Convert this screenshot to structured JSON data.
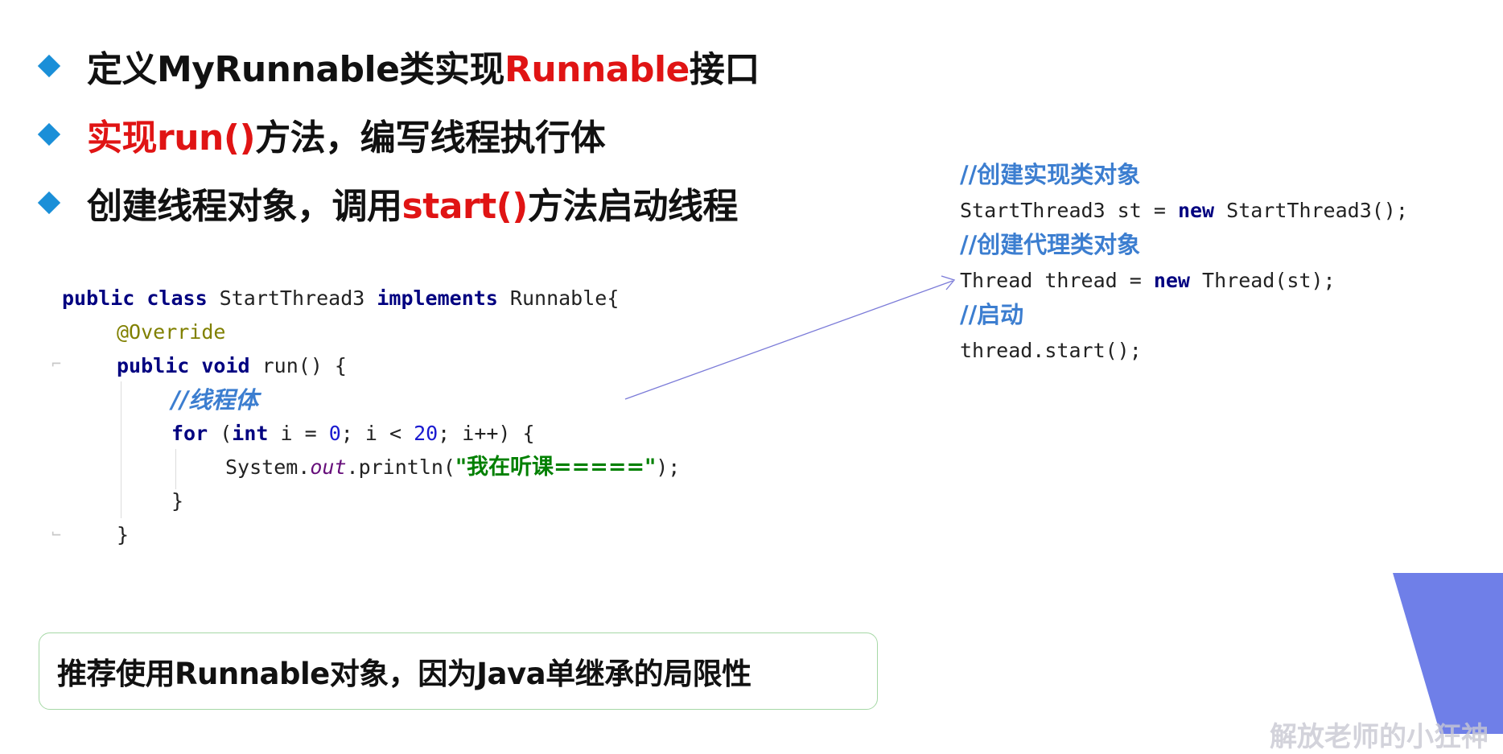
{
  "bullets": [
    {
      "parts": [
        "定义MyRunnable类实现",
        "Runnable",
        "接口"
      ]
    },
    {
      "parts": [
        "实现run()",
        "方法，编写线程执行体"
      ]
    },
    {
      "parts": [
        "创建线程对象，调用",
        "start()",
        "方法启动线程"
      ]
    }
  ],
  "left_code": {
    "l1_public_class": "public class",
    "l1_name": " StartThread3 ",
    "l1_implements": "implements",
    "l1_tail": " Runnable{",
    "l2_annotation": "@Override",
    "l3_public_void": "public void",
    "l3_tail": " run() {",
    "l4_comment": "//线程体",
    "l5_for": "for",
    "l5_a": " (",
    "l5_int": "int",
    "l5_b": " i = ",
    "l5_zero": "0",
    "l5_c": "; i < ",
    "l5_twenty": "20",
    "l5_d": "; i++) {",
    "l6_system": "System.",
    "l6_out": "out",
    "l6_println": ".println(",
    "l6_string": "\"我在听课=====\"",
    "l6_tail": ");",
    "l7_close": "}",
    "l8_close": "}"
  },
  "right_code": {
    "c1": "//创建实现类对象",
    "l1_a": "StartThread3 st = ",
    "l1_new": "new",
    "l1_b": " StartThread3();",
    "c2": "//创建代理类对象",
    "l2_a": "Thread thread = ",
    "l2_new": "new",
    "l2_b": " Thread(st);",
    "c3": "//启动",
    "l3": "thread.start();"
  },
  "note": "推荐使用Runnable对象，因为Java单继承的局限性",
  "watermark": "解放老师的小狂神",
  "colors": {
    "accent_red": "#e01414",
    "bullet_blue": "#1a8fd8",
    "comment_blue": "#3c7ed0",
    "keyword_navy": "#000080",
    "decor_purple": "#6f7fe8"
  }
}
